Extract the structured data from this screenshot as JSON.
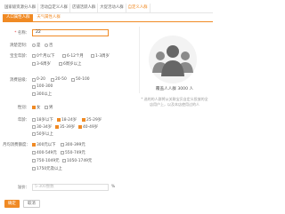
{
  "tabs": [
    "国家级资源分人群",
    "活动自定义人群",
    "店铺活跃人群",
    "大促活动人群",
    "自定义人群"
  ],
  "subtabs": {
    "active": "人口属性人群",
    "inactive": "天气属性人群"
  },
  "form": {
    "name_label": "名称：",
    "name_value": "22",
    "clear_label": "清楚定制：",
    "clear_options": [
      {
        "label": "是",
        "checked": false
      },
      {
        "label": "否",
        "checked": false
      }
    ],
    "age_label": "宝宝年龄：",
    "age_options": [
      {
        "label": "0个月以下",
        "checked": false
      },
      {
        "label": "6-12个月",
        "checked": false
      },
      {
        "label": "1-3周岁",
        "checked": false
      },
      {
        "label": "3-6周岁",
        "checked": false
      },
      {
        "label": "6周岁以上",
        "checked": false
      }
    ],
    "consume_label": "消费层级：",
    "consume_options": [
      {
        "label": "0-20",
        "checked": false
      },
      {
        "label": "20-50",
        "checked": false
      },
      {
        "label": "50-100",
        "checked": false
      },
      {
        "label": "100-300",
        "checked": false
      },
      {
        "label": "300以上",
        "checked": false
      }
    ],
    "gender_label": "性别：",
    "gender_options": [
      {
        "label": "女",
        "checked": true
      },
      {
        "label": "男",
        "checked": false
      }
    ],
    "agegroup_label": "年龄：",
    "agegroup_options": [
      {
        "label": "18岁以下",
        "checked": false
      },
      {
        "label": "18-24岁",
        "checked": true
      },
      {
        "label": "25-29岁",
        "checked": true
      },
      {
        "label": "30-34岁",
        "checked": false
      },
      {
        "label": "35-39岁",
        "checked": true
      },
      {
        "label": "40-49岁",
        "checked": true
      },
      {
        "label": "50岁以上",
        "checked": false
      }
    ],
    "spend_label": "月均消费额度：",
    "spend_options": [
      {
        "label": "300元以下",
        "checked": true
      },
      {
        "label": "300-399元",
        "checked": false
      },
      {
        "label": "400-549元",
        "checked": false
      },
      {
        "label": "550-749元",
        "checked": false
      },
      {
        "label": "750-1049元",
        "checked": false
      },
      {
        "label": "1050-1749元",
        "checked": false
      },
      {
        "label": "1750元及以上",
        "checked": false
      }
    ],
    "budget_label": "溢价：",
    "budget_placeholder": "5-300整数",
    "budget_unit": "%"
  },
  "buttons": {
    "save": "确定",
    "cancel": "取消"
  },
  "preview": {
    "count": "覆盖人人群 3000 人",
    "note": "* 选的的人群将从关联宝贝自定义投放的全店用户上，以及本店使用过的人"
  },
  "colors": {
    "accent": "#f08a24",
    "icon": "#777777"
  }
}
